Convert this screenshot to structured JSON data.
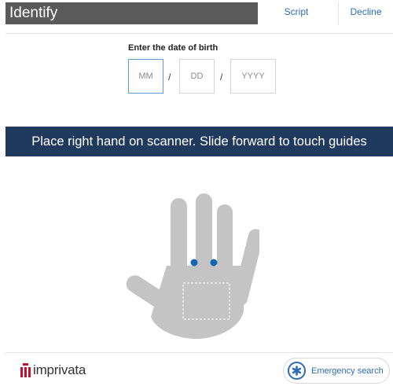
{
  "header": {
    "title": "Identify",
    "script_label": "Script",
    "decline_label": "Decline"
  },
  "dob": {
    "label": "Enter the date of birth",
    "month_placeholder": "MM",
    "day_placeholder": "DD",
    "year_placeholder": "YYYY",
    "separator": "/"
  },
  "instruction": "Place right hand on scanner. Slide forward to touch guides",
  "hand_guide": {
    "hand_color": "#c4c4c4",
    "touch_guide_color": "#1565b0",
    "icon": "hand-icon"
  },
  "footer": {
    "brand_name": "imprivata",
    "brand_color": "#c8102e",
    "emergency_label": "Emergency search",
    "emergency_icon": "asterisk-medical-icon"
  },
  "colors": {
    "banner": "#1f3a5c",
    "link": "#2a6cb5",
    "header_bar": "#5a5a5a"
  }
}
